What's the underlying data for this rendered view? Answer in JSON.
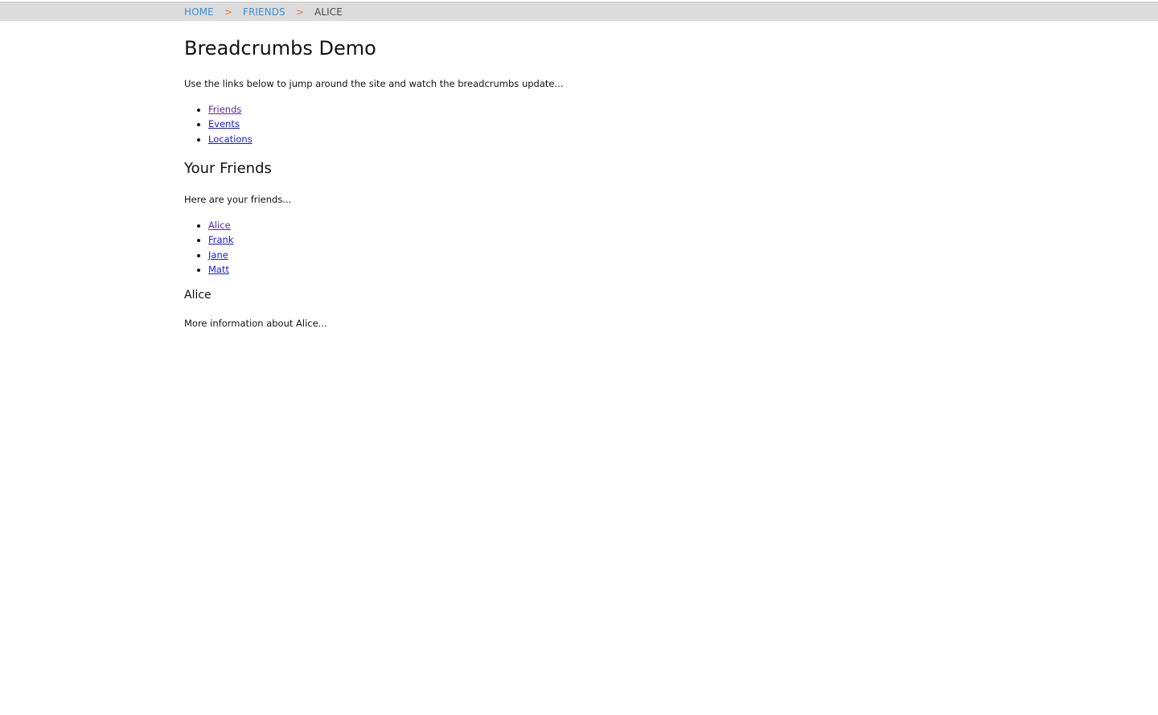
{
  "breadcrumb": {
    "home": "HOME",
    "friends": "FRIENDS",
    "current": "ALICE",
    "separator": ">"
  },
  "page": {
    "title": "Breadcrumbs Demo",
    "intro": "Use the links below to jump around the site and watch the breadcrumbs update...",
    "nav_links": [
      "Friends",
      "Events",
      "Locations"
    ]
  },
  "friends_section": {
    "title": "Your Friends",
    "text": "Here are your friends...",
    "links": [
      "Alice",
      "Frank",
      "Jane",
      "Matt"
    ]
  },
  "detail": {
    "title": "Alice",
    "text": "More information about Alice..."
  },
  "colors": {
    "breadcrumb_bar": "#dcdcdc",
    "breadcrumb_link": "#3a8fd3",
    "breadcrumb_separator": "#e07b2a",
    "link": "#1a1ad6",
    "visited_link": "#5a2aa6"
  }
}
